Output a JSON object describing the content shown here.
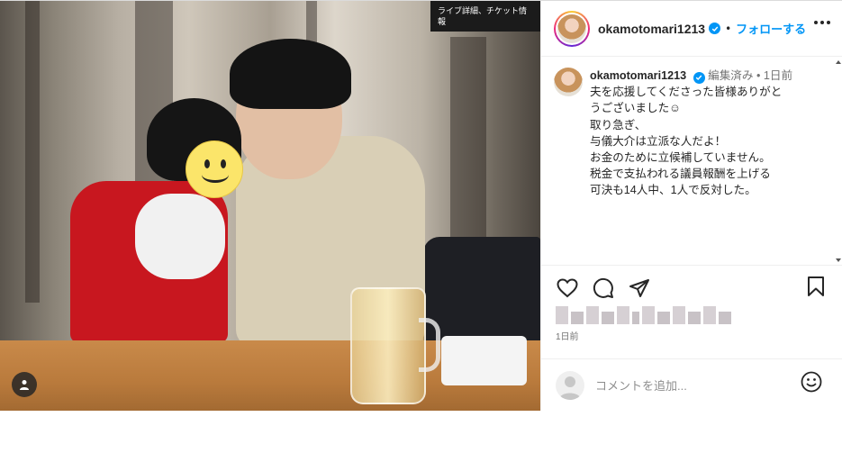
{
  "photo": {
    "poster_text": "ライブ詳細、チケット情報"
  },
  "header": {
    "username": "okamotomari1213",
    "separator": "•",
    "follow_label": "フォローする"
  },
  "caption": {
    "username": "okamotomari1213",
    "edited": "編集済み",
    "separator": "•",
    "time": "1日前",
    "lines": [
      "夫を応援してくださった皆様ありがと",
      "うございました☺︎",
      "",
      "取り急ぎ、",
      "",
      "与儀大介は立派な人だよ！",
      "お金のために立候補していません。",
      "",
      "税金で支払われる議員報酬を上げる",
      "可決も14人中、1人で反対した。"
    ]
  },
  "meta": {
    "date": "1日前"
  },
  "comment": {
    "placeholder": "コメントを追加..."
  },
  "icons": {
    "tag": "user-tag-icon",
    "verified": "verified-badge-icon",
    "more": "more-options-icon",
    "like": "heart-icon",
    "comment": "comment-icon",
    "share": "share-icon",
    "save": "bookmark-icon",
    "emoji": "emoji-icon"
  },
  "colors": {
    "accent": "#0095f6",
    "text": "#262626",
    "secondary": "#737373",
    "border": "#efefef"
  }
}
